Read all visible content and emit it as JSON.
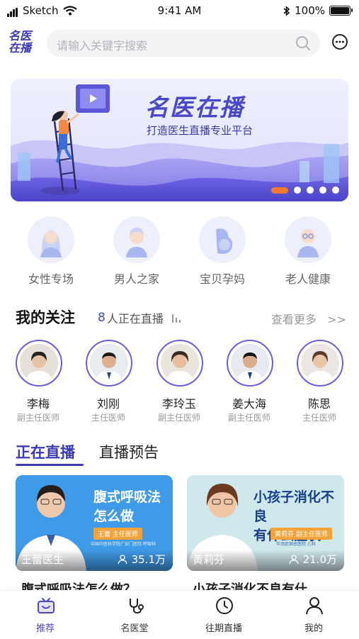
{
  "status_bar": {
    "carrier": "Sketch",
    "time": "9:41 AM",
    "battery": "100%"
  },
  "header": {
    "logo_line1": "名医",
    "logo_line2": "在播",
    "search_placeholder": "请输入关键字搜索"
  },
  "banner": {
    "title": "名医在播",
    "subtitle": "打造医生直播专业平台",
    "slide_count": 5,
    "active_slide": 1
  },
  "categories": [
    {
      "label": "女性专场",
      "icon": "woman-icon"
    },
    {
      "label": "男人之家",
      "icon": "man-icon"
    },
    {
      "label": "宝贝孕妈",
      "icon": "pregnant-icon"
    },
    {
      "label": "老人健康",
      "icon": "elder-icon"
    }
  ],
  "follow": {
    "title": "我的关注",
    "live_count": "8",
    "live_suffix": "人正在直播",
    "more": "查看更多",
    "more_arrow": ">>"
  },
  "doctors": [
    {
      "name": "李梅",
      "title": "副主任医师"
    },
    {
      "name": "刘刚",
      "title": "主任医师"
    },
    {
      "name": "李玲玉",
      "title": "副主任医师"
    },
    {
      "name": "姜大海",
      "title": "副主任医师"
    },
    {
      "name": "陈思",
      "title": "主任医师"
    }
  ],
  "tabs": {
    "live": "正在直播",
    "preview": "直播预告"
  },
  "live_cards": [
    {
      "headline_line1": "腹式呼吸法",
      "headline_line2": "怎么做",
      "badge": "王蕾  主任医师",
      "hospital": "中国中医科学院广安门医院   呼吸科",
      "doctor": "王蕾医生",
      "views": "35.1万",
      "caption": "腹式呼吸法怎么做？",
      "bg_color": "#3f9be8"
    },
    {
      "headline_line1": "小孩子消化不良",
      "headline_line2": "有什么症状",
      "badge": "黄莉芬  副主任医师",
      "hospital": "华润武钢总医院   儿科",
      "doctor": "黄莉芬",
      "views": "21.0万",
      "caption": "小孩子消化不良有什",
      "bg_color": "#cfe8ec"
    }
  ],
  "tabbar": [
    {
      "label": "推荐",
      "icon": "tv-icon",
      "active": true
    },
    {
      "label": "名医堂",
      "icon": "stethoscope-icon",
      "active": false
    },
    {
      "label": "往期直播",
      "icon": "clock-icon",
      "active": false
    },
    {
      "label": "我的",
      "icon": "person-icon",
      "active": false
    }
  ],
  "colors": {
    "accent": "#3d3ab5",
    "indicator": "#f07a2e"
  }
}
